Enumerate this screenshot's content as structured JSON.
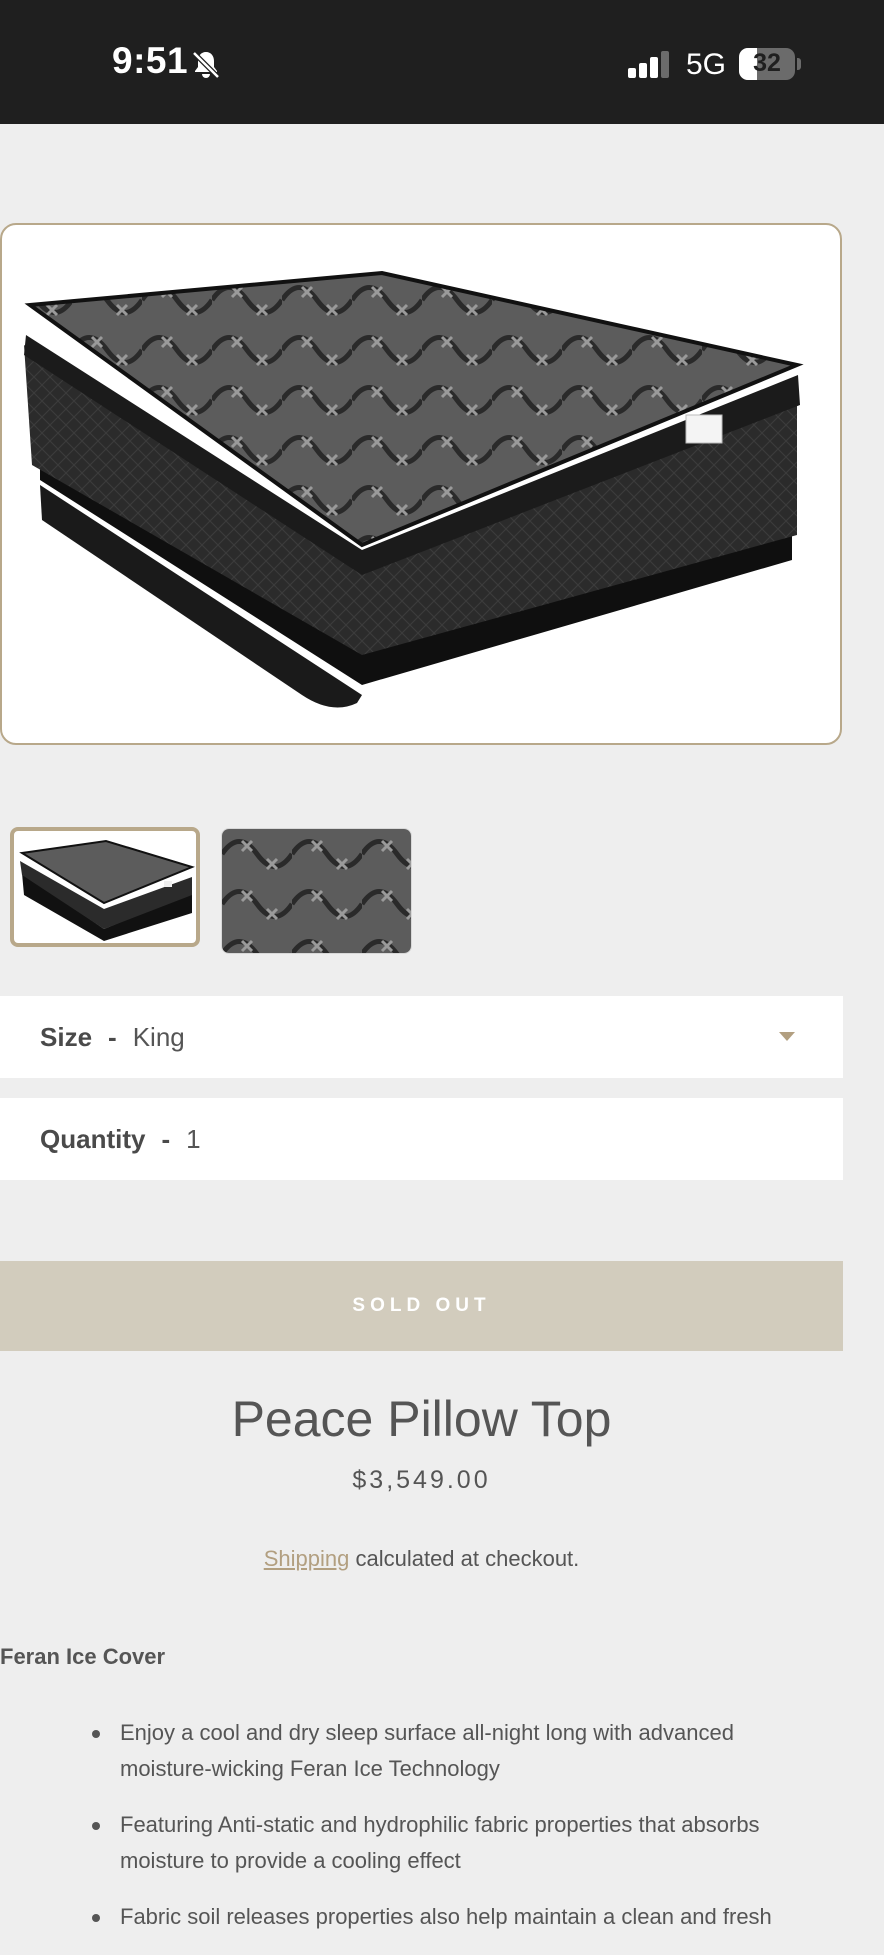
{
  "status_bar": {
    "time": "9:51",
    "network": "5G",
    "battery": "32",
    "battery_level": 0.32
  },
  "gallery": {
    "main_image": "mattress-pillow-top-photo",
    "thumbnails": [
      "mattress-thumbnail",
      "fabric-pattern-thumbnail"
    ],
    "selected_index": 0
  },
  "options": {
    "size_label": "Size",
    "size_sep": "-",
    "size_value": "King",
    "quantity_label": "Quantity",
    "quantity_sep": "-",
    "quantity_value": "1"
  },
  "cta": {
    "sold_out_label": "SOLD OUT"
  },
  "product": {
    "title": "Peace Pillow Top",
    "price": "$3,549.00"
  },
  "shipping": {
    "link_text": "Shipping",
    "note": " calculated at checkout."
  },
  "description": {
    "heading": "Feran Ice Cover",
    "bullets": [
      "Enjoy a cool and dry sleep surface all-night long with advanced moisture-wicking Feran Ice Technology",
      "Featuring Anti-static and hydrophilic fabric properties that absorbs moisture to provide a cooling effect",
      "Fabric soil releases properties also help maintain a clean and fresh"
    ]
  },
  "colors": {
    "accent": "#b8a88a",
    "sold_out_bg": "#d2ccbd",
    "page_bg": "#eeeeee",
    "status_bar_bg": "#1f1f1f"
  }
}
